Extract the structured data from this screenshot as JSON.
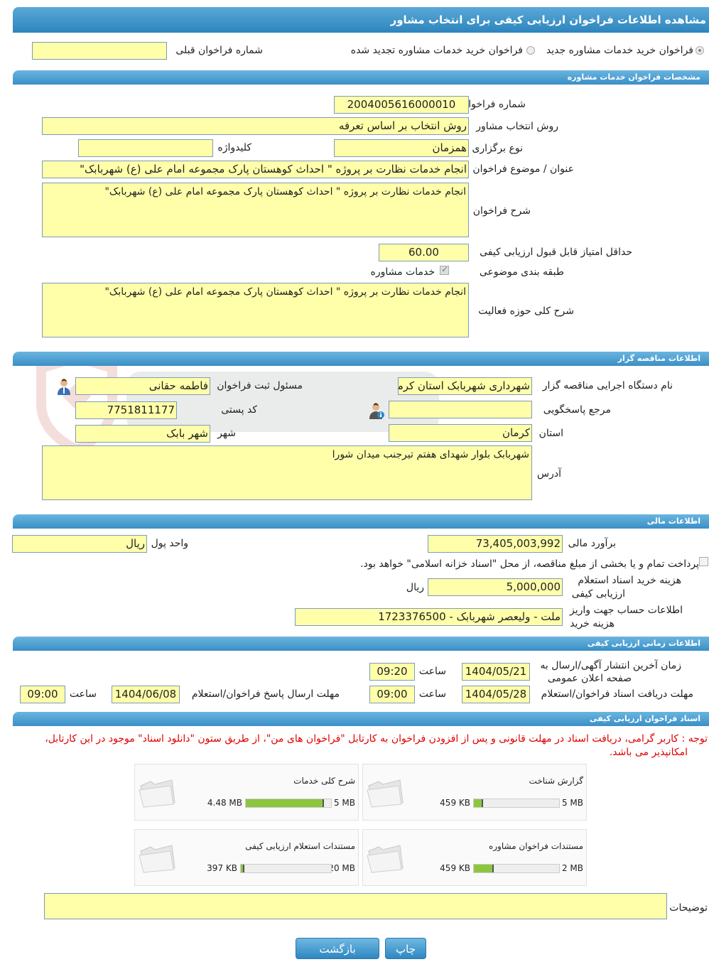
{
  "page_title": "مشاهده اطلاعات فراخوان ارزیابی کیفی برای انتخاب مشاور",
  "mode": {
    "option_new": "فراخوان خرید خدمات مشاوره جدید",
    "option_renewed": "فراخوان خرید خدمات مشاوره تجدید شده",
    "prev_number_label": "شماره فراخوان قبلی",
    "prev_number_value": ""
  },
  "sections": {
    "consulting": "مشخصات فراخوان خدمات مشاوره",
    "tenderer": "اطلاعات مناقصه گزار",
    "financial": "اطلاعات مالی",
    "timing": "اطلاعات زمانی ارزیابی کیفی",
    "documents": "اسناد فراخوان ارزیابی کیفی"
  },
  "consulting": {
    "number_label": "شماره فراخوان",
    "number_value": "2004005616000010",
    "method_label": "روش انتخاب مشاور",
    "method_value": "روش انتخاب بر اساس تعرفه",
    "holding_label": "نوع برگزاری",
    "holding_value": "همزمان",
    "keyword_label": "کلیدواژه",
    "keyword_value": "",
    "subject_label": "عنوان / موضوع فراخوان",
    "subject_value": "انجام خدمات نظارت بر پروژه \" احداث کوهستان پارک مجموعه امام علی (ع) شهربابک\"",
    "desc_label": "شرح فراخوان",
    "desc_value": "انجام خدمات نظارت بر پروژه \" احداث کوهستان پارک مجموعه امام علی (ع) شهربابک\"",
    "min_score_label": "حداقل امتیاز قابل قبول ارزیابی کیفی",
    "min_score_value": "60.00",
    "category_label": "طبقه بندی موضوعی",
    "category_value": "خدمات مشاوره",
    "scope_label": "شرح کلی حوزه فعالیت",
    "scope_value": "انجام خدمات نظارت بر پروژه \" احداث کوهستان پارک مجموعه امام علی (ع) شهربابک\""
  },
  "tenderer": {
    "org_label": "نام دستگاه اجرایی مناقصه گزار",
    "org_value": "شهرداری شهربابک استان کرمان",
    "registrar_label": "مسئول ثبت فراخوان",
    "registrar_value": "فاطمه حقانی",
    "ref_label": "مرجع پاسخگویی",
    "ref_value": "",
    "postal_label": "کد پستی",
    "postal_value": "7751811177",
    "province_label": "استان",
    "province_value": "کرمان",
    "city_label": "شهر",
    "city_value": "شهر بابک",
    "address_label": "آدرس",
    "address_value": "شهربابک بلوار شهدای هفتم تیرجنب میدان شورا"
  },
  "financial": {
    "estimate_label": "برآورد مالی",
    "estimate_value": "73,405,003,992",
    "currency_label": "واحد پول",
    "currency_value": "ریال",
    "treasury_text": "پرداخت تمام و یا بخشی از مبلغ مناقصه، از محل \"اسناد خزانه اسلامی\" خواهد بود.",
    "doc_fee_label_1": "هزینه خرید اسناد استعلام",
    "doc_fee_label_2": "ارزیابی کیفی",
    "doc_fee_value": "5,000,000",
    "doc_fee_unit": "ریال",
    "account_label_1": "اطلاعات حساب جهت واریز",
    "account_label_2": "هزینه خرید",
    "account_value": "ملت - ولیعصر شهربابک - 1723376500"
  },
  "timing": {
    "publish_label_1": "زمان آخرین انتشار آگهی/ارسال به",
    "publish_label_2": "صفحه اعلان عمومی",
    "publish_date": "1404/05/21",
    "publish_time": "09:20",
    "time_label": "ساعت",
    "receive_label": "مهلت دریافت اسناد فراخوان/استعلام",
    "receive_date": "1404/05/28",
    "receive_time": "09:00",
    "reply_label": "مهلت ارسال پاسخ فراخوان/استعلام",
    "reply_date": "1404/06/08",
    "reply_time": "09:00"
  },
  "documents": {
    "note_line1": "توجه : کاربر گرامی، دریافت اسناد در مهلت قانونی و پس از افزودن فراخوان به کارتابل \"فراخوان های من\"، از طریق ستون \"دانلود اسناد\" موجود در این کارتابل،",
    "note_line2": "امکانپذیر می باشد.",
    "files": [
      {
        "title": "گزارش شناخت",
        "used": "459 KB",
        "max": "5 MB",
        "fraction": 0.09
      },
      {
        "title": "شرح کلی خدمات",
        "used": "4.48 MB",
        "max": "5 MB",
        "fraction": 0.9
      },
      {
        "title": "مستندات فراخوان مشاوره",
        "used": "459 KB",
        "max": "2 MB",
        "fraction": 0.22
      },
      {
        "title": "مستندات استعلام ارزیابی کیفی",
        "used": "397 KB",
        "max": "20 MB",
        "fraction": 0.02
      }
    ]
  },
  "remarks_label": "توضیحات",
  "remarks_value": "",
  "buttons": {
    "print": "چاپ",
    "back": "بازگشت"
  },
  "colors": {
    "field_bg": "#ffffaa",
    "header_blue": "#2d84bd",
    "bar_green": "#8cc63f",
    "note_red": "#e00000"
  }
}
